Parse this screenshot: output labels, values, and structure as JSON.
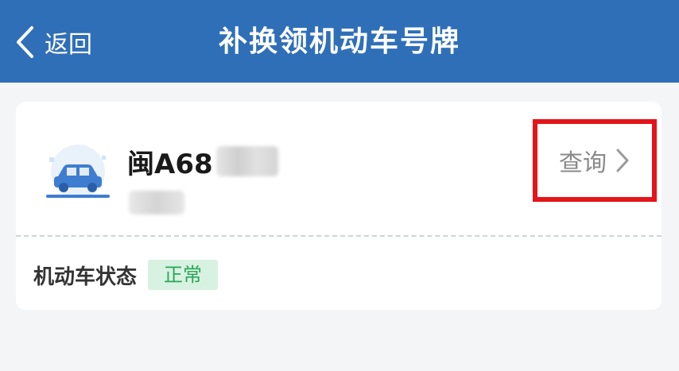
{
  "header": {
    "back_label": "返回",
    "title": "补换领机动车号牌",
    "background": "#2f6fb8"
  },
  "vehicle": {
    "icon": "car-icon",
    "plate_prefix": "闽A68",
    "query_label": "查询",
    "query_icon": "chevron-right-icon",
    "highlight_color": "#e4141a"
  },
  "status": {
    "label": "机动车状态",
    "value": "正常",
    "badge_color": "#2aa657"
  }
}
